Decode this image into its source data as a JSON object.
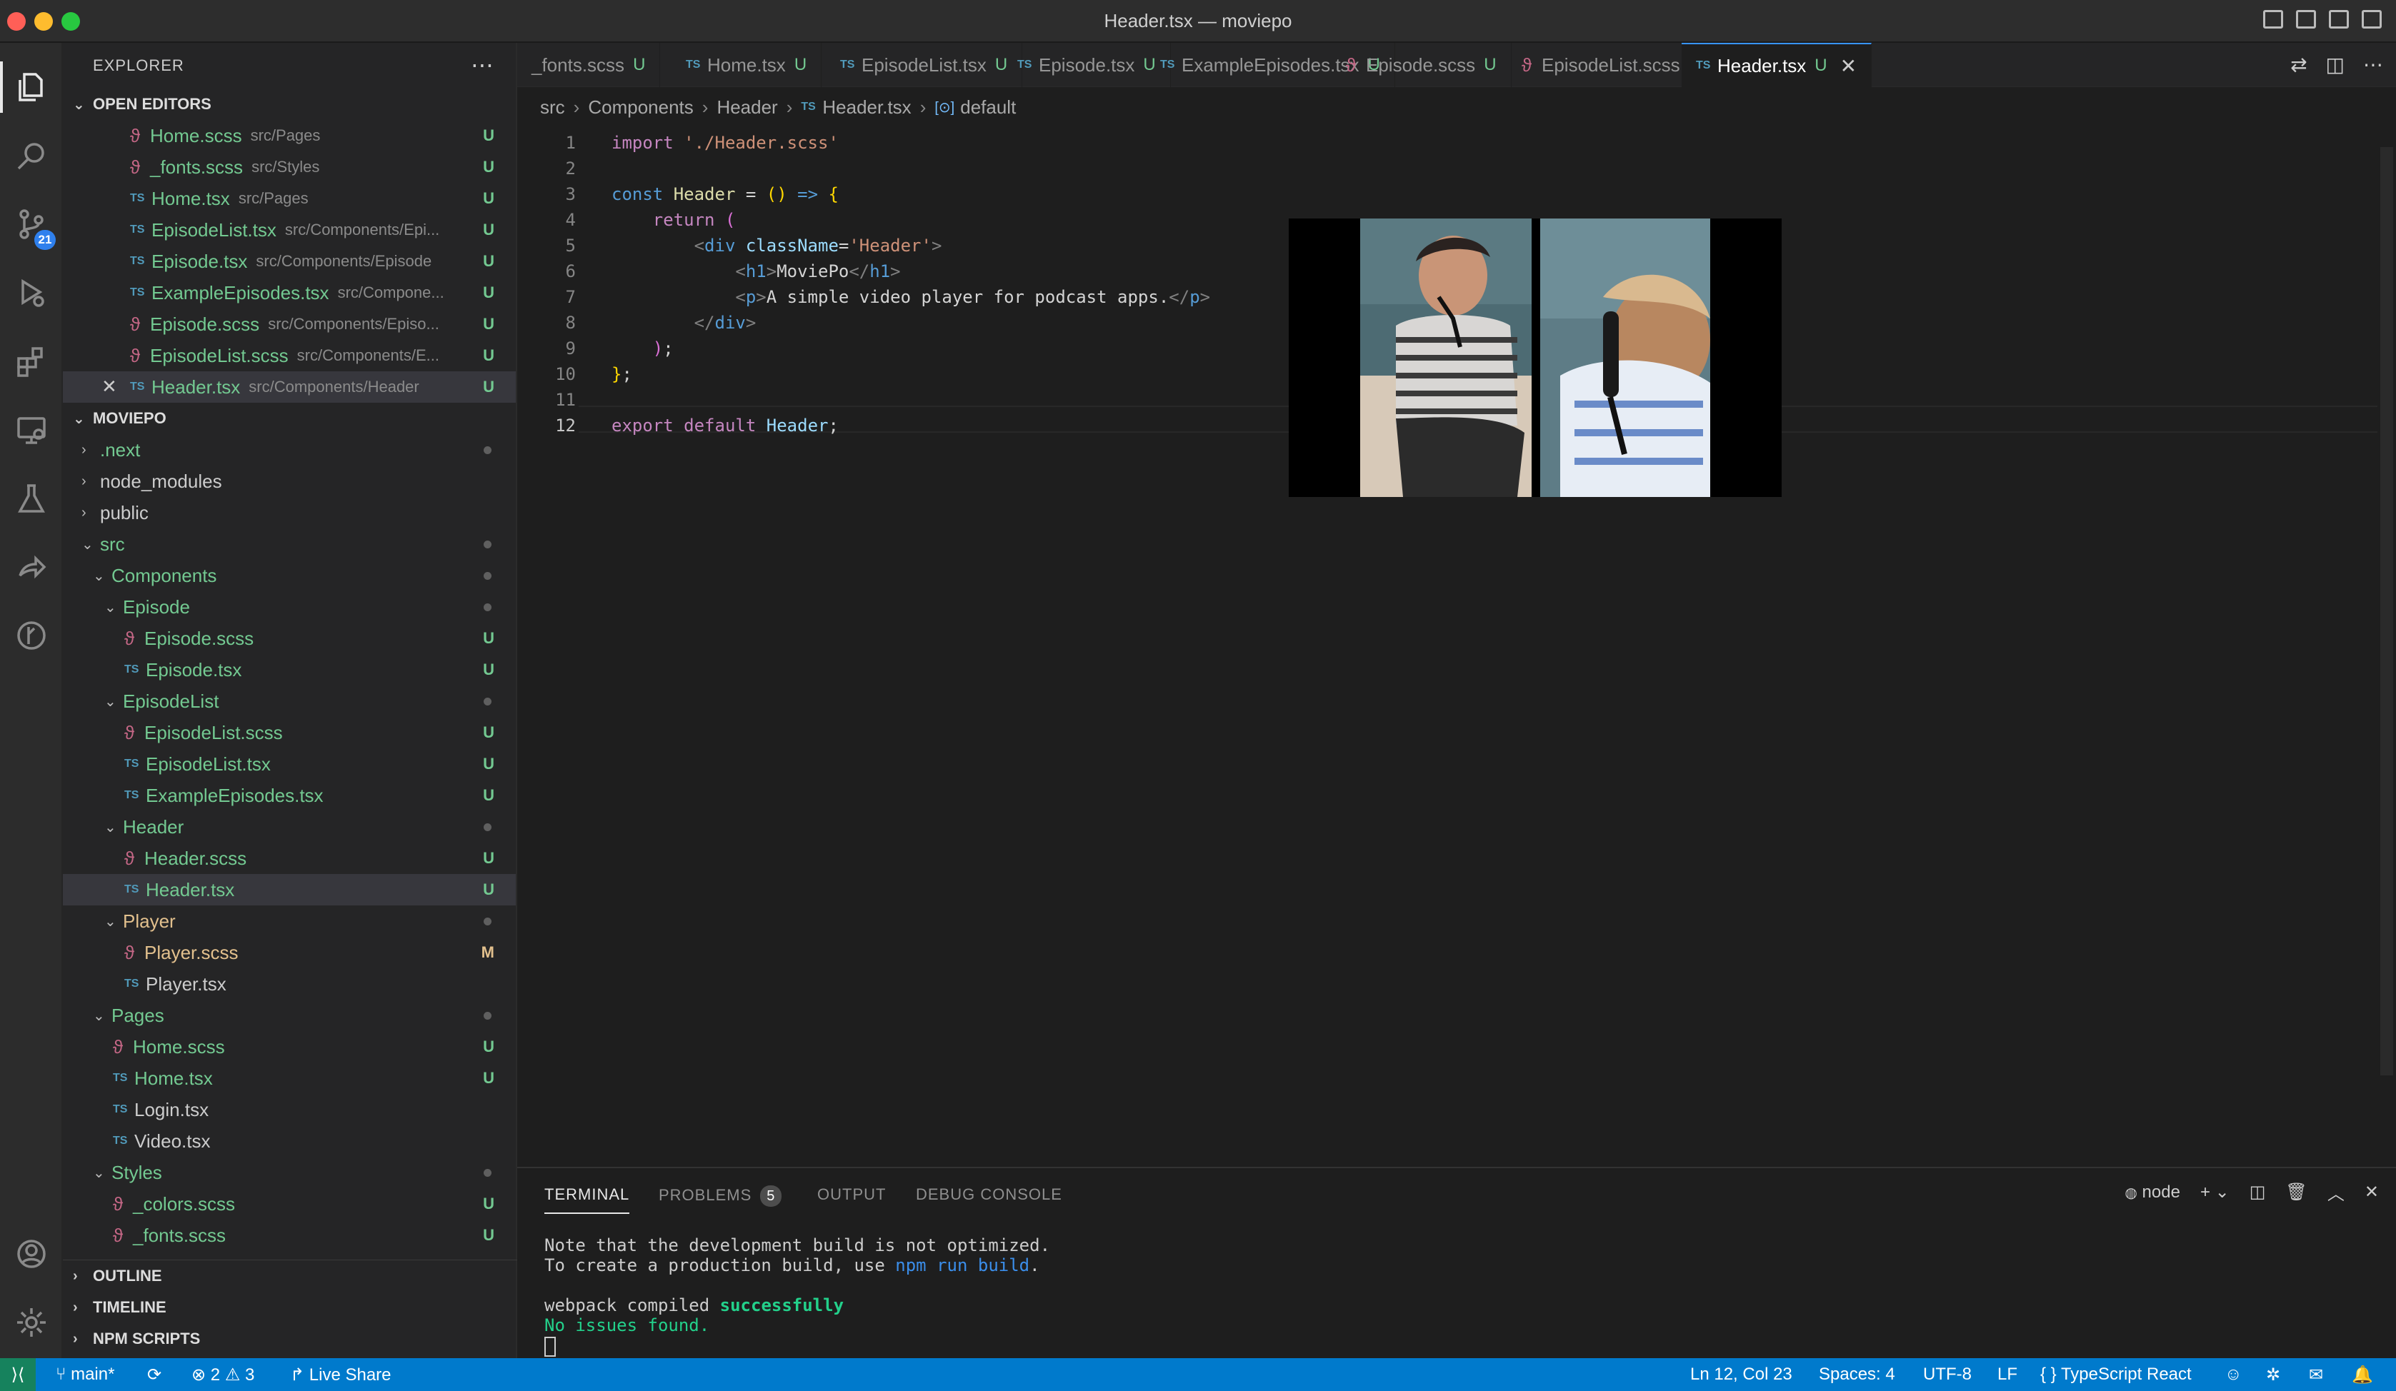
{
  "window": {
    "title": "Header.tsx — moviepo"
  },
  "activity_bar": {
    "items": [
      {
        "name": "explorer-icon"
      },
      {
        "name": "search-icon"
      },
      {
        "name": "source-control-icon",
        "badge": "21"
      },
      {
        "name": "run-debug-icon"
      },
      {
        "name": "extensions-icon"
      },
      {
        "name": "remote-explorer-icon"
      },
      {
        "name": "testing-icon"
      },
      {
        "name": "live-share-icon"
      },
      {
        "name": "git-graph-icon"
      }
    ]
  },
  "sidebar": {
    "title": "EXPLORER",
    "open_editors_label": "OPEN EDITORS",
    "open_editors": [
      {
        "type": "scss",
        "name": "Home.scss",
        "path": "src/Pages",
        "status": "U"
      },
      {
        "type": "scss",
        "name": "_fonts.scss",
        "path": "src/Styles",
        "status": "U"
      },
      {
        "type": "ts",
        "name": "Home.tsx",
        "path": "src/Pages",
        "status": "U"
      },
      {
        "type": "ts",
        "name": "EpisodeList.tsx",
        "path": "src/Components/Epi...",
        "status": "U"
      },
      {
        "type": "ts",
        "name": "Episode.tsx",
        "path": "src/Components/Episode",
        "status": "U"
      },
      {
        "type": "ts",
        "name": "ExampleEpisodes.tsx",
        "path": "src/Compone...",
        "status": "U"
      },
      {
        "type": "scss",
        "name": "Episode.scss",
        "path": "src/Components/Episo...",
        "status": "U"
      },
      {
        "type": "scss",
        "name": "EpisodeList.scss",
        "path": "src/Components/E...",
        "status": "U"
      },
      {
        "type": "ts",
        "name": "Header.tsx",
        "path": "src/Components/Header",
        "status": "U"
      }
    ],
    "project_label": "MOVIEPO",
    "tree": [
      {
        "kind": "folder",
        "open": false,
        "name": ".next",
        "indent": 0,
        "dot": true
      },
      {
        "kind": "folder",
        "open": false,
        "name": "node_modules",
        "indent": 0
      },
      {
        "kind": "folder",
        "open": false,
        "name": "public",
        "indent": 0
      },
      {
        "kind": "folder",
        "open": true,
        "name": "src",
        "indent": 0,
        "dot": true
      },
      {
        "kind": "folder",
        "open": true,
        "name": "Components",
        "indent": 1,
        "dot": true
      },
      {
        "kind": "folder",
        "open": true,
        "name": "Episode",
        "indent": 2,
        "dot": true
      },
      {
        "kind": "scss",
        "name": "Episode.scss",
        "indent": 3,
        "status": "U"
      },
      {
        "kind": "ts",
        "name": "Episode.tsx",
        "indent": 3,
        "status": "U"
      },
      {
        "kind": "folder",
        "open": true,
        "name": "EpisodeList",
        "indent": 2,
        "dot": true
      },
      {
        "kind": "scss",
        "name": "EpisodeList.scss",
        "indent": 3,
        "status": "U"
      },
      {
        "kind": "ts",
        "name": "EpisodeList.tsx",
        "indent": 3,
        "status": "U"
      },
      {
        "kind": "ts",
        "name": "ExampleEpisodes.tsx",
        "indent": 3,
        "status": "U"
      },
      {
        "kind": "folder",
        "open": true,
        "name": "Header",
        "indent": 2,
        "dot": true
      },
      {
        "kind": "scss",
        "name": "Header.scss",
        "indent": 3,
        "status": "U"
      },
      {
        "kind": "ts",
        "name": "Header.tsx",
        "indent": 3,
        "status": "U"
      },
      {
        "kind": "folder",
        "open": true,
        "name": "Player",
        "indent": 2,
        "dot": true
      },
      {
        "kind": "scss",
        "name": "Player.scss",
        "indent": 3,
        "status": "M"
      },
      {
        "kind": "ts",
        "name": "Player.tsx",
        "indent": 3
      },
      {
        "kind": "folder",
        "open": true,
        "name": "Pages",
        "indent": 1,
        "dot": true
      },
      {
        "kind": "scss",
        "name": "Home.scss",
        "indent": 2,
        "status": "U"
      },
      {
        "kind": "ts",
        "name": "Home.tsx",
        "indent": 2,
        "status": "U"
      },
      {
        "kind": "ts",
        "name": "Login.tsx",
        "indent": 2
      },
      {
        "kind": "ts",
        "name": "Video.tsx",
        "indent": 2
      },
      {
        "kind": "folder",
        "open": true,
        "name": "Styles",
        "indent": 1,
        "dot": true
      },
      {
        "kind": "scss",
        "name": "_colors.scss",
        "indent": 2,
        "status": "U"
      },
      {
        "kind": "scss",
        "name": "_fonts.scss",
        "indent": 2,
        "status": "U"
      }
    ],
    "bottom_sections": [
      "OUTLINE",
      "TIMELINE",
      "NPM SCRIPTS"
    ]
  },
  "tabs": [
    {
      "name": "_fonts.scss",
      "status": "U",
      "type": "scss"
    },
    {
      "name": "Home.tsx",
      "status": "U",
      "type": "ts"
    },
    {
      "name": "EpisodeList.tsx",
      "status": "U",
      "type": "ts"
    },
    {
      "name": "Episode.tsx",
      "status": "U",
      "type": "ts"
    },
    {
      "name": "ExampleEpisodes.tsx",
      "status": "U",
      "type": "ts"
    },
    {
      "name": "Episode.scss",
      "status": "U",
      "type": "scss"
    },
    {
      "name": "EpisodeList.scss",
      "status": "U",
      "type": "scss"
    },
    {
      "name": "Header.tsx",
      "status": "U",
      "type": "ts",
      "active": true
    }
  ],
  "breadcrumb": [
    "src",
    "Components",
    "Header",
    "Header.tsx",
    "default"
  ],
  "editor": {
    "current_line": 12,
    "lines": [
      {
        "n": "1",
        "text": "import './Header.scss'"
      },
      {
        "n": "2",
        "text": ""
      },
      {
        "n": "3",
        "text": "const Header = () => {"
      },
      {
        "n": "4",
        "text": "    return ("
      },
      {
        "n": "5",
        "text": "        <div className='Header'>"
      },
      {
        "n": "6",
        "text": "            <h1>MoviePo</h1>"
      },
      {
        "n": "7",
        "text": "            <p>A simple video player for podcast apps.</p>"
      },
      {
        "n": "8",
        "text": "        </div>"
      },
      {
        "n": "9",
        "text": "    );"
      },
      {
        "n": "10",
        "text": "};"
      },
      {
        "n": "11",
        "text": ""
      },
      {
        "n": "12",
        "text": "export default Header;"
      }
    ]
  },
  "panel": {
    "tabs": [
      {
        "label": "TERMINAL",
        "active": true
      },
      {
        "label": "PROBLEMS",
        "badge": "5"
      },
      {
        "label": "OUTPUT"
      },
      {
        "label": "DEBUG CONSOLE"
      }
    ],
    "shell": "node",
    "terminal": {
      "line1": "Note that the development build is not optimized.",
      "line2_pre": "To create a production build, use ",
      "line2_cmd": "npm run build",
      "line2_post": ".",
      "line3_pre": "webpack compiled ",
      "line3_status": "successfully",
      "line4": "No issues found."
    }
  },
  "statusbar": {
    "branch": "main*",
    "errors": "2",
    "warnings": "3",
    "live_share": "Live Share",
    "position": "Ln 12, Col 23",
    "spaces": "Spaces: 4",
    "encoding": "UTF-8",
    "eol": "LF",
    "language": "TypeScript React"
  },
  "colors": {
    "accent": "#007acc",
    "untracked": "#73c991",
    "modified": "#e2c08d"
  }
}
